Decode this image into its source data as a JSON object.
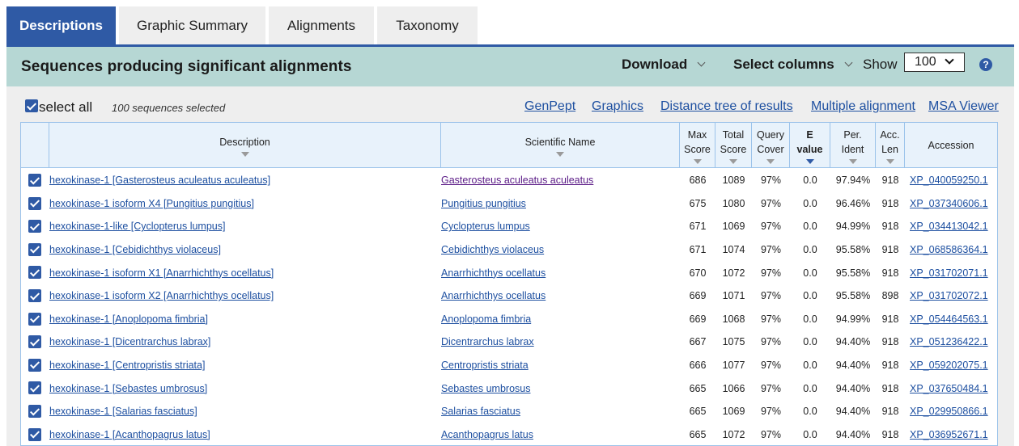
{
  "tabs": [
    {
      "label": "Descriptions",
      "active": true
    },
    {
      "label": "Graphic Summary",
      "active": false
    },
    {
      "label": "Alignments",
      "active": false
    },
    {
      "label": "Taxonomy",
      "active": false
    }
  ],
  "toolbar": {
    "title": "Sequences producing significant alignments",
    "download_label": "Download",
    "select_columns_label": "Select columns",
    "show_label": "Show",
    "show_value": "100",
    "help_icon": "?"
  },
  "selection": {
    "select_all_label": "select all",
    "count_text": "100 sequences selected",
    "links": [
      "GenPept",
      "Graphics",
      "Distance tree of results",
      "Multiple alignment",
      "MSA Viewer"
    ]
  },
  "columns": {
    "description": "Description",
    "scientific_name": "Scientific Name",
    "max_score": [
      "Max",
      "Score"
    ],
    "total_score": [
      "Total",
      "Score"
    ],
    "query_cover": [
      "Query",
      "Cover"
    ],
    "e_value": [
      "E",
      "value"
    ],
    "per_ident": [
      "Per.",
      "Ident"
    ],
    "acc_len": [
      "Acc.",
      "Len"
    ],
    "accession": "Accession"
  },
  "rows": [
    {
      "desc": "hexokinase-1 [Gasterosteus aculeatus aculeatus]",
      "sci": "Gasterosteus aculeatus aculeatus",
      "max": "686",
      "total": "1089",
      "cover": "97%",
      "e": "0.0",
      "ident": "97.94%",
      "len": "918",
      "acc": "XP_040059250.1",
      "visited": true
    },
    {
      "desc": "hexokinase-1 isoform X4 [Pungitius pungitius]",
      "sci": "Pungitius pungitius",
      "max": "675",
      "total": "1080",
      "cover": "97%",
      "e": "0.0",
      "ident": "96.46%",
      "len": "918",
      "acc": "XP_037340606.1"
    },
    {
      "desc": "hexokinase-1-like [Cyclopterus lumpus]",
      "sci": "Cyclopterus lumpus",
      "max": "671",
      "total": "1069",
      "cover": "97%",
      "e": "0.0",
      "ident": "94.99%",
      "len": "918",
      "acc": "XP_034413042.1"
    },
    {
      "desc": "hexokinase-1 [Cebidichthys violaceus]",
      "sci": "Cebidichthys violaceus",
      "max": "671",
      "total": "1074",
      "cover": "97%",
      "e": "0.0",
      "ident": "95.58%",
      "len": "918",
      "acc": "XP_068586364.1"
    },
    {
      "desc": "hexokinase-1 isoform X1 [Anarrhichthys ocellatus]",
      "sci": "Anarrhichthys ocellatus",
      "max": "670",
      "total": "1072",
      "cover": "97%",
      "e": "0.0",
      "ident": "95.58%",
      "len": "918",
      "acc": "XP_031702071.1"
    },
    {
      "desc": "hexokinase-1 isoform X2 [Anarrhichthys ocellatus]",
      "sci": "Anarrhichthys ocellatus",
      "max": "669",
      "total": "1071",
      "cover": "97%",
      "e": "0.0",
      "ident": "95.58%",
      "len": "898",
      "acc": "XP_031702072.1"
    },
    {
      "desc": "hexokinase-1 [Anoplopoma fimbria]",
      "sci": "Anoplopoma fimbria",
      "max": "669",
      "total": "1068",
      "cover": "97%",
      "e": "0.0",
      "ident": "94.99%",
      "len": "918",
      "acc": "XP_054464563.1"
    },
    {
      "desc": "hexokinase-1 [Dicentrarchus labrax]",
      "sci": "Dicentrarchus labrax",
      "max": "667",
      "total": "1075",
      "cover": "97%",
      "e": "0.0",
      "ident": "94.40%",
      "len": "918",
      "acc": "XP_051236422.1"
    },
    {
      "desc": "hexokinase-1 [Centropristis striata]",
      "sci": "Centropristis striata",
      "max": "666",
      "total": "1077",
      "cover": "97%",
      "e": "0.0",
      "ident": "94.40%",
      "len": "918",
      "acc": "XP_059202075.1"
    },
    {
      "desc": "hexokinase-1 [Sebastes umbrosus]",
      "sci": "Sebastes umbrosus",
      "max": "665",
      "total": "1066",
      "cover": "97%",
      "e": "0.0",
      "ident": "94.40%",
      "len": "918",
      "acc": "XP_037650484.1"
    },
    {
      "desc": "hexokinase-1 [Salarias fasciatus]",
      "sci": "Salarias fasciatus",
      "max": "665",
      "total": "1069",
      "cover": "97%",
      "e": "0.0",
      "ident": "94.40%",
      "len": "918",
      "acc": "XP_029950866.1"
    },
    {
      "desc": "hexokinase-1 [Acanthopagrus latus]",
      "sci": "Acanthopagrus latus",
      "max": "665",
      "total": "1072",
      "cover": "97%",
      "e": "0.0",
      "ident": "94.40%",
      "len": "918",
      "acc": "XP_036952671.1"
    }
  ]
}
